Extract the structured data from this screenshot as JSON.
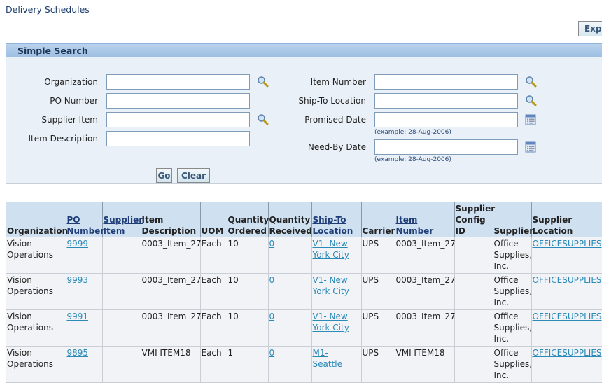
{
  "page": {
    "title": "Delivery Schedules",
    "export_label": "Export"
  },
  "search": {
    "header": "Simple Search",
    "fields": {
      "organization": {
        "label": "Organization",
        "value": ""
      },
      "po_number": {
        "label": "PO Number",
        "value": ""
      },
      "supplier_item": {
        "label": "Supplier Item",
        "value": ""
      },
      "item_description": {
        "label": "Item Description",
        "value": ""
      },
      "item_number": {
        "label": "Item Number",
        "value": ""
      },
      "ship_to_location": {
        "label": "Ship-To Location",
        "value": ""
      },
      "promised_date": {
        "label": "Promised Date",
        "value": "",
        "hint": "(example: 28-Aug-2006)"
      },
      "need_by_date": {
        "label": "Need-By Date",
        "value": "",
        "hint": "(example: 28-Aug-2006)"
      }
    },
    "go_label": "Go",
    "clear_label": "Clear"
  },
  "table": {
    "columns": [
      {
        "label": "Organization",
        "sortable": false
      },
      {
        "label": "PO Number",
        "sortable": true
      },
      {
        "label": "Supplier Item",
        "sortable": true
      },
      {
        "label": "Item Description",
        "sortable": false
      },
      {
        "label": "UOM",
        "sortable": false
      },
      {
        "label": "Quantity Ordered",
        "sortable": false
      },
      {
        "label": "Quantity Received",
        "sortable": false
      },
      {
        "label": "Ship-To Location",
        "sortable": true
      },
      {
        "label": "Carrier",
        "sortable": false
      },
      {
        "label": "Item Number",
        "sortable": true
      },
      {
        "label": "Supplier Config ID",
        "sortable": false
      },
      {
        "label": "Supplier",
        "sortable": false
      },
      {
        "label": "Supplier Location",
        "sortable": false
      }
    ],
    "rows": [
      {
        "organization": "Vision Operations",
        "po_number": "9999",
        "supplier_item": "",
        "item_description": "0003_Item_27",
        "uom": "Each",
        "qty_ordered": "10",
        "qty_received": "0",
        "ship_to": "V1- New York City",
        "carrier": "UPS",
        "item_number": "0003_Item_27",
        "supplier_config_id": "",
        "supplier": "Office Supplies, Inc.",
        "supplier_location": "OFFICESUPPLIES"
      },
      {
        "organization": "Vision Operations",
        "po_number": "9993",
        "supplier_item": "",
        "item_description": "0003_Item_27",
        "uom": "Each",
        "qty_ordered": "10",
        "qty_received": "0",
        "ship_to": "V1- New York City",
        "carrier": "UPS",
        "item_number": "0003_Item_27",
        "supplier_config_id": "",
        "supplier": "Office Supplies, Inc.",
        "supplier_location": "OFFICESUPPLIES"
      },
      {
        "organization": "Vision Operations",
        "po_number": "9991",
        "supplier_item": "",
        "item_description": "0003_Item_27",
        "uom": "Each",
        "qty_ordered": "10",
        "qty_received": "0",
        "ship_to": "V1- New York City",
        "carrier": "UPS",
        "item_number": "0003_Item_27",
        "supplier_config_id": "",
        "supplier": "Office Supplies, Inc.",
        "supplier_location": "OFFICESUPPLIES"
      },
      {
        "organization": "Vision Operations",
        "po_number": "9895",
        "supplier_item": "",
        "item_description": "VMI ITEM18",
        "uom": "Each",
        "qty_ordered": "1",
        "qty_received": "0",
        "ship_to": "M1- Seattle",
        "carrier": "UPS",
        "item_number": "VMI ITEM18",
        "supplier_config_id": "",
        "supplier": "Office Supplies, Inc.",
        "supplier_location": "OFFICESUPPLIES"
      }
    ]
  },
  "icons": {
    "lov": "magnifier-icon",
    "calendar": "calendar-icon"
  }
}
